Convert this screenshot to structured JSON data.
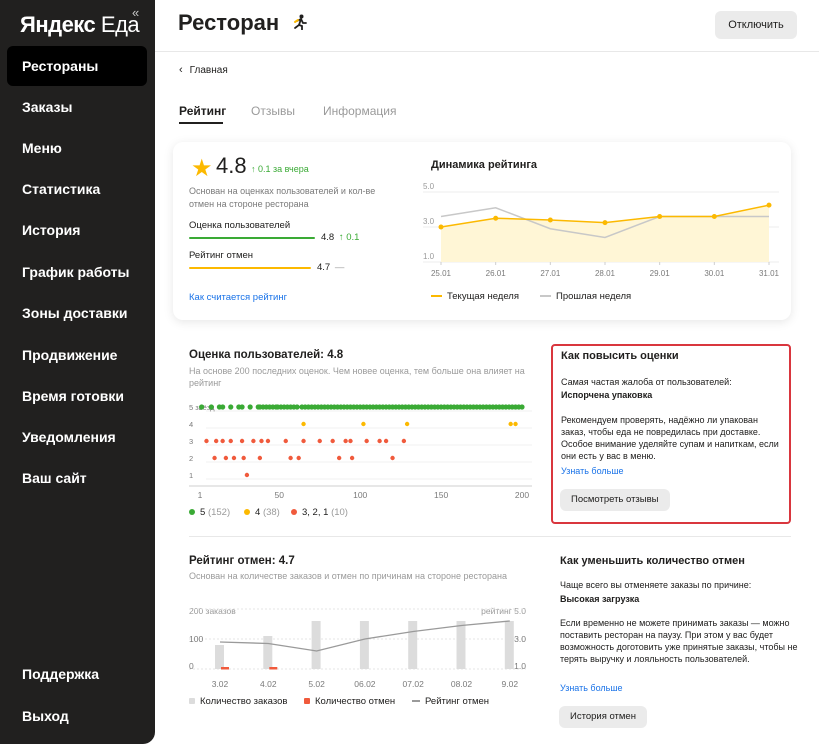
{
  "sidebar": {
    "logo_bold": "Яндекс",
    "logo_rest": "Еда",
    "collapse_icon": "«",
    "items": [
      {
        "label": "Рестораны",
        "active": true
      },
      {
        "label": "Заказы"
      },
      {
        "label": "Меню"
      },
      {
        "label": "Статистика"
      },
      {
        "label": "История"
      },
      {
        "label": "График работы"
      },
      {
        "label": "Зоны доставки"
      },
      {
        "label": "Продвижение"
      },
      {
        "label": "Время готовки"
      },
      {
        "label": "Уведомления"
      },
      {
        "label": "Ваш сайт"
      }
    ],
    "bottom_items": [
      {
        "label": "Поддержка"
      },
      {
        "label": "Выход"
      }
    ]
  },
  "header": {
    "title": "Ресторан",
    "status_icon": "running-person-icon",
    "disable_button": "Отключить"
  },
  "breadcrumb": {
    "label": "Главная"
  },
  "tabs": [
    {
      "label": "Рейтинг",
      "active": true
    },
    {
      "label": "Отзывы"
    },
    {
      "label": "Информация"
    }
  ],
  "rating_card": {
    "rating": "4.8",
    "delta": "↑ 0.1 за вчера",
    "description": "Основан на оценках пользователей и кол-ве отмен на стороне ресторана",
    "metric1_label": "Оценка пользователей",
    "metric1_value": "4.8",
    "metric1_delta": "↑ 0.1",
    "metric2_label": "Рейтинг отмен",
    "metric2_value": "4.7",
    "metric2_delta": "—",
    "how_link": "Как считается рейтинг",
    "colors": {
      "accent": "#fcb900",
      "green": "#3aaa35",
      "red": "#f05a3c",
      "link": "#1a73e8"
    }
  },
  "chart_data": [
    {
      "type": "line",
      "title": "Динамика рейтинга",
      "categories": [
        "25.01",
        "26.01",
        "27.01",
        "28.01",
        "29.01",
        "30.01",
        "31.01"
      ],
      "y_ticks": [
        "5.0",
        "3.0",
        "1.0"
      ],
      "ylim": [
        1,
        5
      ],
      "series": [
        {
          "name": "Текущая неделя",
          "color": "#fcb900",
          "values": [
            3.0,
            3.5,
            3.4,
            3.25,
            3.6,
            3.6,
            4.25
          ]
        },
        {
          "name": "Прошлая неделя",
          "color": "#c8c8c8",
          "values": [
            3.6,
            4.1,
            2.9,
            2.4,
            3.6,
            3.6,
            3.6
          ]
        }
      ],
      "legend": "bottom"
    },
    {
      "type": "scatter",
      "title": "Оценка пользователей: 4.8",
      "subtitle": "На основе 200 последних оценок. Чем новее оценка, тем больше она влияет на рейтинг",
      "y_ticks": [
        "5 звёзд",
        "4",
        "3",
        "2",
        "1"
      ],
      "x_ticks": [
        "1",
        "50",
        "100",
        "150",
        "200"
      ],
      "series": [
        {
          "name": "5",
          "count": "(152)",
          "color": "#3aaa35",
          "y": 5,
          "x": [
            2,
            8,
            13,
            15,
            20,
            25,
            27,
            32,
            37,
            38,
            40,
            42,
            44,
            46,
            48,
            49,
            51,
            53,
            55,
            57,
            59,
            61,
            64,
            66,
            68,
            70,
            72,
            74,
            76,
            78,
            80,
            82,
            84,
            86,
            88,
            90,
            92,
            94,
            96,
            98,
            100,
            102,
            104,
            106,
            108,
            110,
            112,
            114,
            116,
            118,
            120,
            122,
            124,
            126,
            128,
            130,
            132,
            134,
            136,
            138,
            140,
            142,
            144,
            146,
            148,
            150,
            152,
            154,
            156,
            158,
            160,
            162,
            164,
            166,
            168,
            170,
            172,
            174,
            176,
            178,
            180,
            182,
            184,
            186,
            188,
            190,
            192,
            194,
            196,
            198,
            200
          ]
        },
        {
          "name": "4",
          "count": "(38)",
          "color": "#fcb900",
          "y": 4,
          "x": [
            65,
            102,
            129,
            193,
            196
          ]
        },
        {
          "name": "3, 2, 1",
          "count": "(10)",
          "color": "#f05a3c",
          "series_points": [
            {
              "y": 3,
              "x": [
                5,
                11,
                15,
                20,
                27,
                34,
                39,
                43,
                54,
                65,
                75,
                83,
                91,
                94,
                104,
                112,
                116,
                127
              ]
            },
            {
              "y": 2,
              "x": [
                10,
                17,
                22,
                28,
                38,
                57,
                62,
                87,
                95,
                120
              ]
            },
            {
              "y": 1,
              "x": [
                30
              ]
            }
          ]
        }
      ]
    },
    {
      "type": "bar",
      "title": "Рейтинг отмен: 4.7",
      "subtitle": "Основан на количестве заказов и отмен по причинам на стороне ресторана",
      "left_axis_label": "200 заказов",
      "right_axis_label": "рейтинг 5.0",
      "left_ticks": [
        "100",
        "0"
      ],
      "right_ticks": [
        "3.0",
        "1.0"
      ],
      "categories": [
        "3.02",
        "4.02",
        "5.02",
        "06.02",
        "07.02",
        "08.02",
        "9.02"
      ],
      "series": [
        {
          "name": "Количество заказов",
          "color": "#dcdcdc",
          "values": [
            80,
            110,
            160,
            160,
            160,
            160,
            160
          ]
        },
        {
          "name": "Количество отмен",
          "color": "#f05a3c",
          "values": [
            5,
            5,
            0,
            0,
            0,
            0,
            0
          ]
        },
        {
          "name": "Рейтинг отмен",
          "color": "#9a9a9a",
          "type": "line",
          "values": [
            2.8,
            2.7,
            2.2,
            3.0,
            3.5,
            3.9,
            4.2
          ]
        }
      ]
    }
  ],
  "tip_box": {
    "title": "Как повысить оценки",
    "line1": "Самая частая жалоба от пользователей:",
    "line2": "Испорчена упаковка",
    "body": "Рекомендуем проверять, надёжно ли упакован заказ, чтобы еда не повредилась при доставке. Особое внимание уделяйте супам и напиткам, если они есть у вас в меню.",
    "link": "Узнать больше",
    "button": "Посмотреть отзывы"
  },
  "tip2": {
    "title": "Как уменьшить количество отмен",
    "line1": "Чаще всего вы отменяете заказы по причине:",
    "line2": "Высокая загрузка",
    "body": "Если временно не можете принимать заказы — можно поставить ресторан на паузу. При этом у вас будет возможность доготовить уже принятые заказы, чтобы не терять выручку и лояльность пользователей.",
    "link": "Узнать больше",
    "button": "История отмен"
  }
}
